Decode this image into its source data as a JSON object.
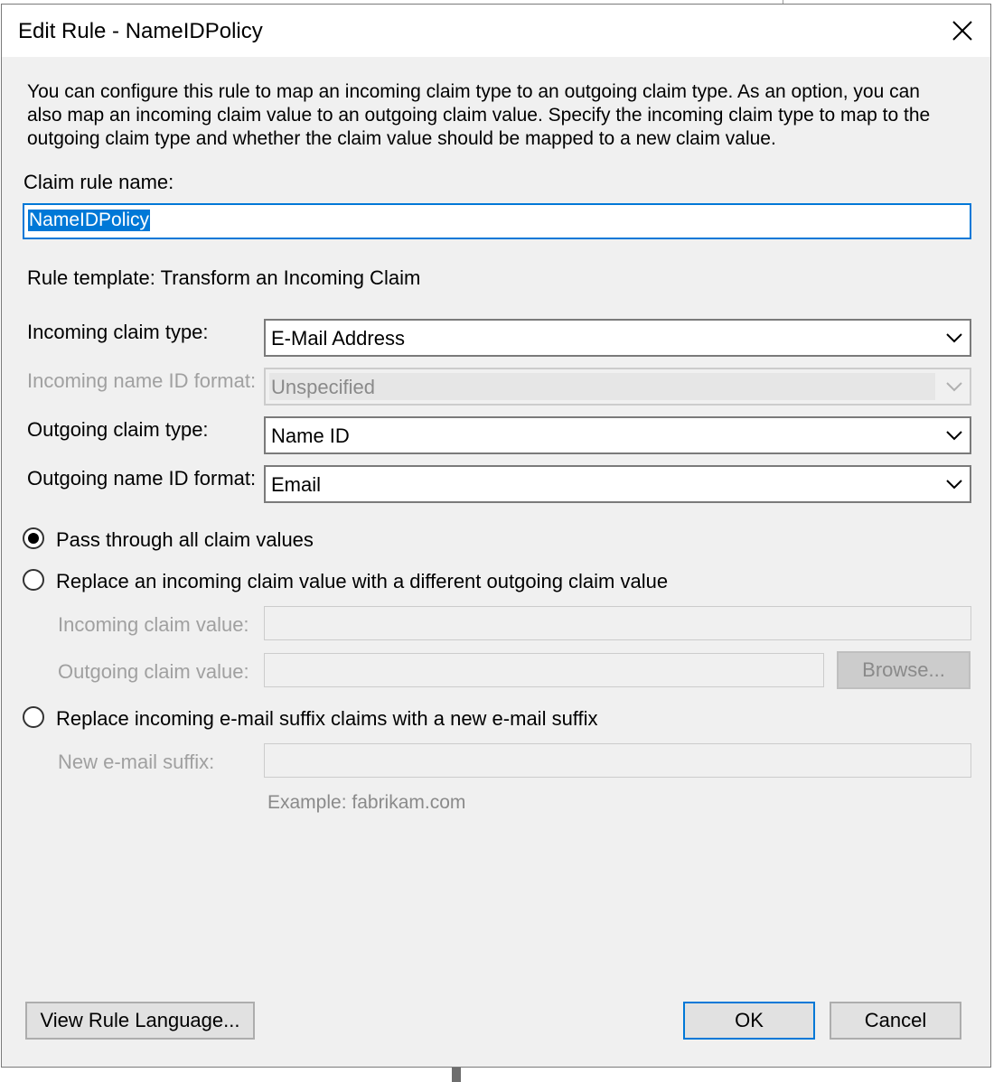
{
  "window": {
    "title": "Edit Rule - NameIDPolicy"
  },
  "description": "You can configure this rule to map an incoming claim type to an outgoing claim type. As an option, you can also map an incoming claim value to an outgoing claim value. Specify the incoming claim type to map to the outgoing claim type and whether the claim value should be mapped to a new claim value.",
  "rule_name": {
    "label": "Claim rule name:",
    "value": "NameIDPolicy"
  },
  "rule_template": "Rule template: Transform an Incoming Claim",
  "fields": {
    "incoming_claim_type": {
      "label": "Incoming claim type:",
      "value": "E-Mail Address"
    },
    "incoming_name_id_format": {
      "label": "Incoming name ID format:",
      "value": "Unspecified"
    },
    "outgoing_claim_type": {
      "label": "Outgoing claim type:",
      "value": "Name ID"
    },
    "outgoing_name_id_format": {
      "label": "Outgoing name ID format:",
      "value": "Email"
    }
  },
  "options": {
    "pass_through": {
      "label": "Pass through all claim values",
      "selected": true
    },
    "replace_value": {
      "label": "Replace an incoming claim value with a different outgoing claim value",
      "selected": false
    },
    "replace_suffix": {
      "label": "Replace incoming e-mail suffix claims with a new e-mail suffix",
      "selected": false
    }
  },
  "replace_value": {
    "incoming_label": "Incoming claim value:",
    "incoming_value": "",
    "outgoing_label": "Outgoing claim value:",
    "outgoing_value": "",
    "browse_label": "Browse..."
  },
  "suffix": {
    "label": "New e-mail suffix:",
    "value": "",
    "example": "Example: fabrikam.com"
  },
  "buttons": {
    "view_rule_language": "View Rule Language...",
    "ok": "OK",
    "cancel": "Cancel"
  },
  "colors": {
    "accent": "#0078d7",
    "dialog_bg": "#f0f0f0",
    "disabled_text": "#a0a0a0"
  }
}
